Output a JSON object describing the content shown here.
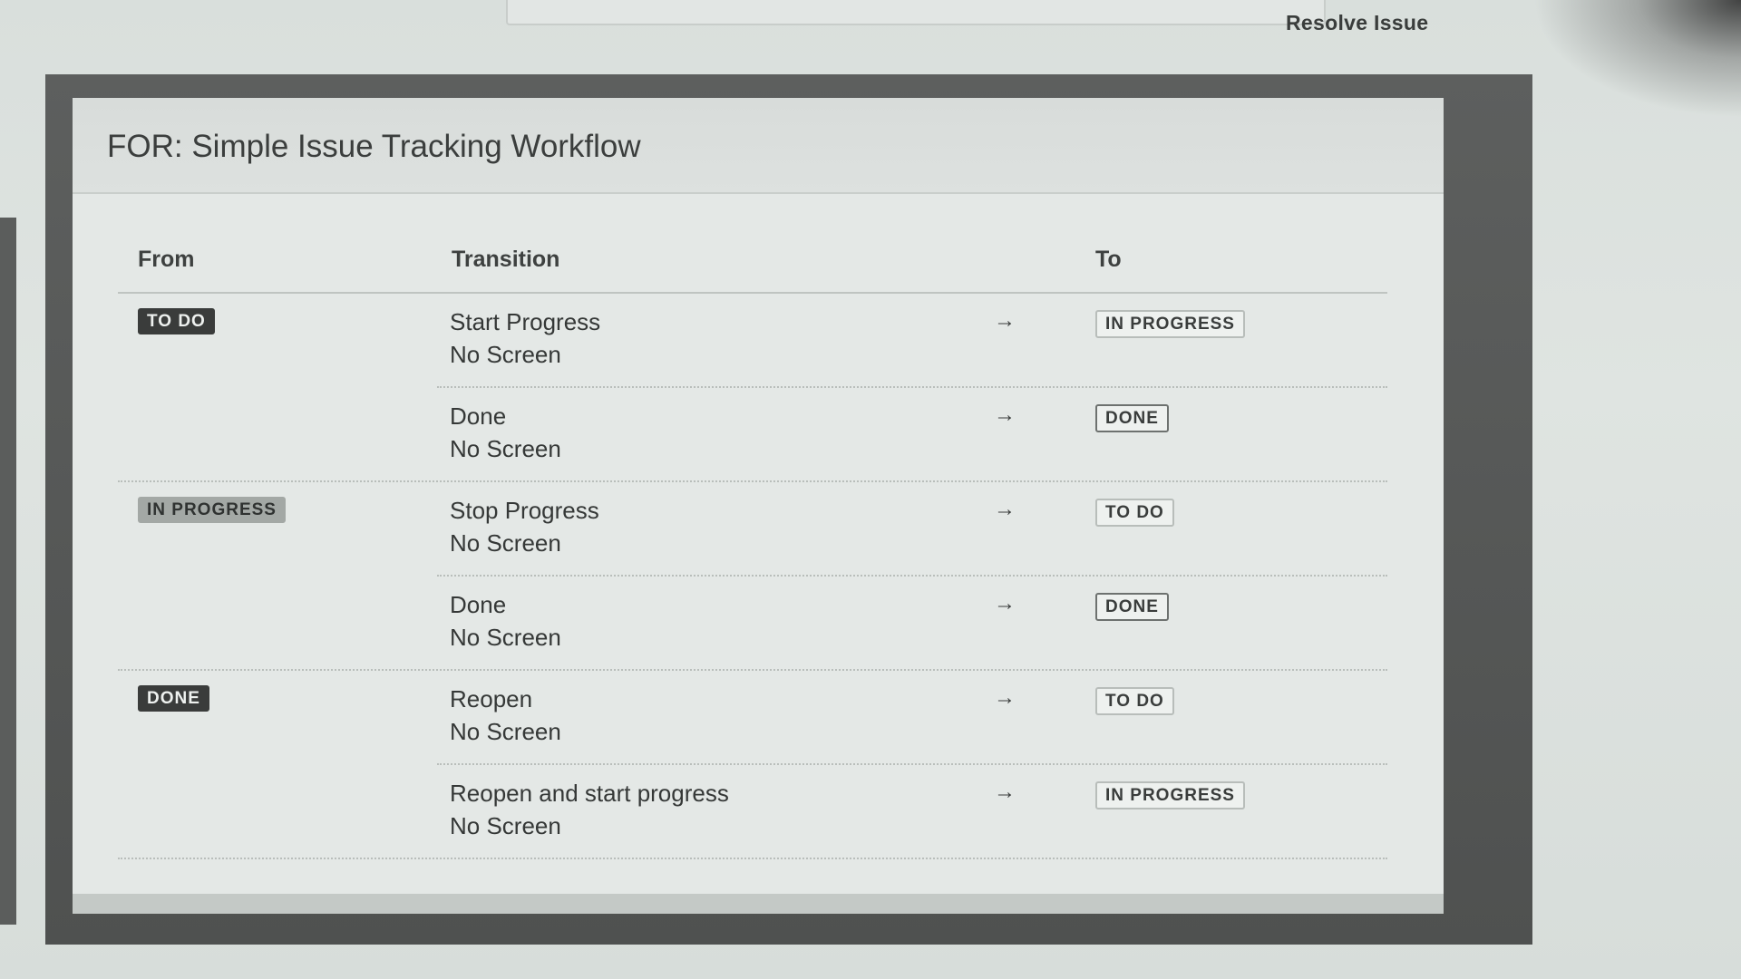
{
  "header_action": "Resolve Issue",
  "dialog": {
    "title": "FOR: Simple Issue Tracking Workflow"
  },
  "table": {
    "columns": {
      "from": "From",
      "transition": "Transition",
      "to": "To"
    },
    "arrow": "→",
    "groups": [
      {
        "from": "TO DO",
        "transitions": [
          {
            "name": "Start Progress",
            "screen": "No Screen",
            "to": "IN PROGRESS"
          },
          {
            "name": "Done",
            "screen": "No Screen",
            "to": "DONE"
          }
        ]
      },
      {
        "from": "IN PROGRESS",
        "transitions": [
          {
            "name": "Stop Progress",
            "screen": "No Screen",
            "to": "TO DO"
          },
          {
            "name": "Done",
            "screen": "No Screen",
            "to": "DONE"
          }
        ]
      },
      {
        "from": "DONE",
        "transitions": [
          {
            "name": "Reopen",
            "screen": "No Screen",
            "to": "TO DO"
          },
          {
            "name": "Reopen and start progress",
            "screen": "No Screen",
            "to": "IN PROGRESS"
          }
        ]
      }
    ]
  },
  "colors": {
    "page_background": "#dfe4e1",
    "dialog_frame": "#555756",
    "lozenge_dark": "#3a3c3b",
    "lozenge_grey": "#a3a8a5"
  }
}
